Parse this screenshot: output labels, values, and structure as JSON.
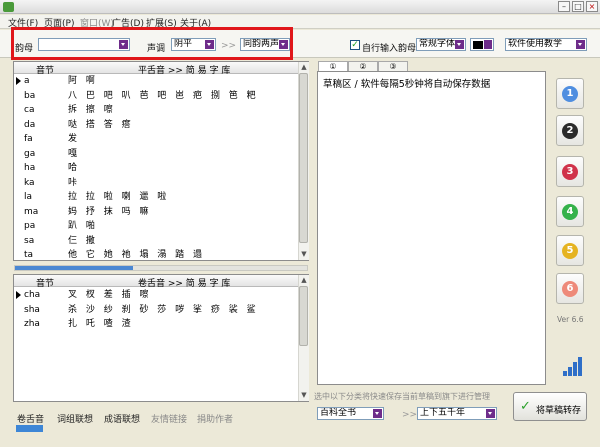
{
  "menu": [
    "文件(F)",
    "页面(P)",
    "窗口(W)",
    "广告(D)",
    "扩展(S)",
    "关于(A)"
  ],
  "toolbar": {
    "rhyme_label": "韵母",
    "rhyme_value": "",
    "tone_label": "声调",
    "tone_value": "阴平",
    "tone_arrows": ">>",
    "tone_mode_value": "同韵两声",
    "auto_input_label": "自行输入韵母",
    "auto_input_checked": "✓",
    "font_select_value": "常规字体",
    "help_value": "软件使用教学"
  },
  "left_top": {
    "col_syllable": "音节",
    "col_words": "平舌音 >> 简 易 字 库",
    "rows": [
      {
        "k": "a",
        "v": "阿 啊"
      },
      {
        "k": "ba",
        "v": "八 巴 吧 叭 芭 吧 岜 疤 捌 笆 粑"
      },
      {
        "k": "ca",
        "v": "拆 擦 嚓"
      },
      {
        "k": "da",
        "v": "哒 搭 答 瘩"
      },
      {
        "k": "fa",
        "v": "发"
      },
      {
        "k": "ga",
        "v": "嘎"
      },
      {
        "k": "ha",
        "v": "哈"
      },
      {
        "k": "ka",
        "v": "咔"
      },
      {
        "k": "la",
        "v": "拉 拉 啦 喇 邋 啦"
      },
      {
        "k": "ma",
        "v": "妈 抒 抹 吗 嘛"
      },
      {
        "k": "pa",
        "v": "趴 啪"
      },
      {
        "k": "sa",
        "v": "仨 撒"
      },
      {
        "k": "ta",
        "v": "他 它 她 祂 塌 溻 踏 遢"
      }
    ]
  },
  "left_bottom": {
    "col_syllable": "音节",
    "col_words": "卷舌音 >> 简 易 字 库",
    "rows": [
      {
        "k": "cha",
        "v": "叉 杈 差 插 嚓"
      },
      {
        "k": "sha",
        "v": "杀 沙 纱 刹 砂 莎 哕 挲 痧 裟 鲨"
      },
      {
        "k": "zha",
        "v": "扎 吒 喳 渣"
      }
    ]
  },
  "bottom_tabs": [
    "卷舌音",
    "词组联想",
    "成语联想",
    "友情链接",
    "捐助作者"
  ],
  "editor": {
    "tabs": [
      "①",
      "②",
      "③"
    ],
    "text": "草稿区 / 软件每隔5秒钟将自动保存数据"
  },
  "right_buttons": [
    "1",
    "2",
    "3",
    "4",
    "5",
    "6"
  ],
  "version": "Ver 6.6",
  "hint": "选中以下分类将快速保存当前草稿到旗下进行管理",
  "footer": {
    "category1": "百科全书",
    "arrows": ">>",
    "category2": "上下五千年",
    "save_label": "将草稿转存"
  }
}
